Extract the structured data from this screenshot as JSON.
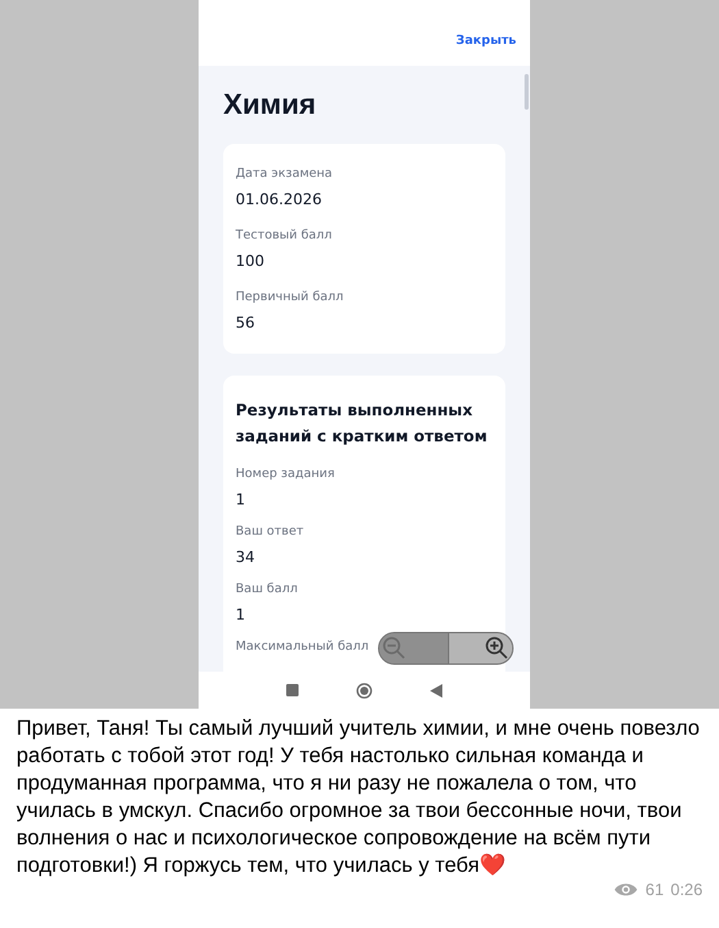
{
  "phone": {
    "close_link": "Закрыть",
    "title": "Химия",
    "exam_card": [
      {
        "label": "Дата экзамена",
        "value": "01.06.2026"
      },
      {
        "label": "Тестовый балл",
        "value": "100"
      },
      {
        "label": "Первичный балл",
        "value": "56"
      }
    ],
    "results_card": {
      "heading": "Результаты выполненных заданий с кратким ответом",
      "fields": [
        {
          "label": "Номер задания",
          "value": "1"
        },
        {
          "label": "Ваш ответ",
          "value": "34"
        },
        {
          "label": "Ваш балл",
          "value": "1"
        },
        {
          "label": "Максимальный балл"
        }
      ]
    }
  },
  "message": {
    "text": "Привет, Таня! Ты самый лучший учитель химии, и мне очень повезло работать с тобой этот год! У тебя настолько сильная команда и продуманная программа, что я ни разу не пожалела о том, что училась в умскул. Спасибо огромное за твои бессонные ночи, твои волнения о нас и психологическое сопровождение на всём пути подготовки!) Я горжусь тем, что училась у тебя❤️",
    "views": "61",
    "time": "0:26"
  }
}
